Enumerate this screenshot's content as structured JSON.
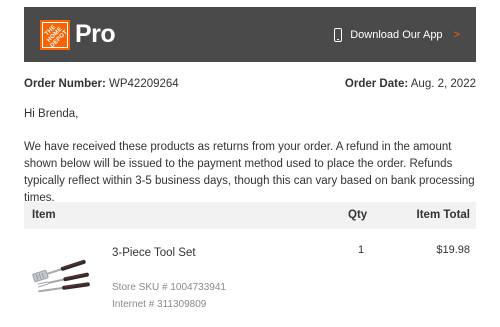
{
  "header": {
    "logo_lines": [
      "THE",
      "HOME",
      "DEPOT"
    ],
    "brand": "Pro",
    "app_link": "Download Our App",
    "app_chevron": ">"
  },
  "order": {
    "number_label": "Order Number:",
    "number": "WP42209264",
    "date_label": "Order Date:",
    "date": "Aug. 2, 2022"
  },
  "greeting": "Hi Brenda,",
  "message": "We have received these products as returns from your order. A refund in the amount shown below will be issued to the payment method used to place the order. Refunds typically reflect within 3-5 business days, though this can vary based on bank processing times.",
  "table": {
    "headers": {
      "item": "Item",
      "qty": "Qty",
      "total": "Item Total"
    },
    "rows": [
      {
        "name": "3-Piece Tool Set",
        "qty": "1",
        "total": "$19.98",
        "sku": "Store SKU # 1004733941",
        "internet": "Internet # 311309809"
      }
    ]
  },
  "colors": {
    "accent": "#f96302",
    "header_bg": "#4a4a4a",
    "table_header_bg": "#f2f2f2"
  }
}
